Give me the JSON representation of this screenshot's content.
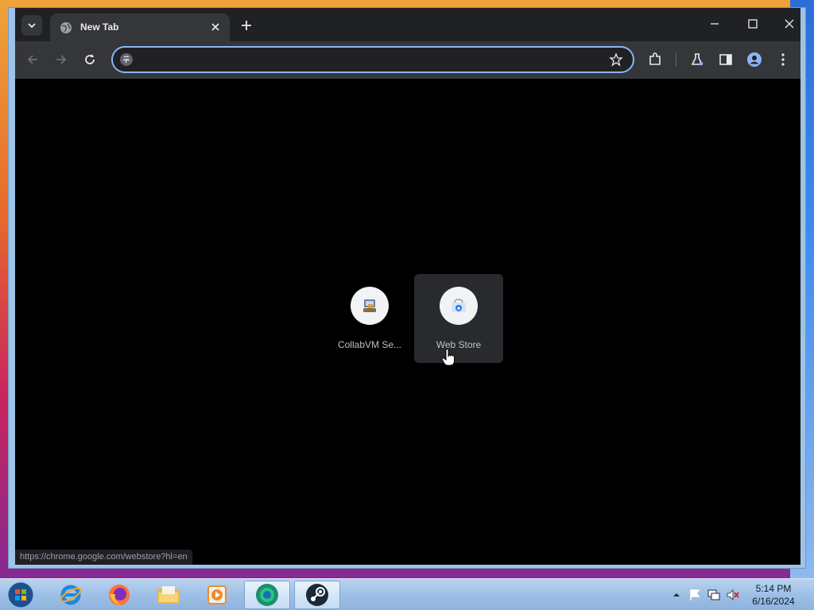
{
  "browser": {
    "tab": {
      "title": "New Tab"
    },
    "omnibox": {
      "value": "",
      "placeholder": ""
    },
    "accent_color": "#8ab4f8"
  },
  "new_tab_page": {
    "shortcuts": [
      {
        "label": "CollabVM Se...",
        "icon": "collabvm-icon"
      },
      {
        "label": "Web Store",
        "icon": "web-store-icon"
      }
    ],
    "status_url": "https://chrome.google.com/webstore?hl=en"
  },
  "taskbar": {
    "apps": [
      "start-orb",
      "internet-explorer-icon",
      "firefox-icon",
      "file-explorer-icon",
      "media-player-icon",
      "chrome-icon",
      "steam-icon"
    ],
    "clock": {
      "time": "5:14 PM",
      "date": "6/16/2024"
    }
  }
}
